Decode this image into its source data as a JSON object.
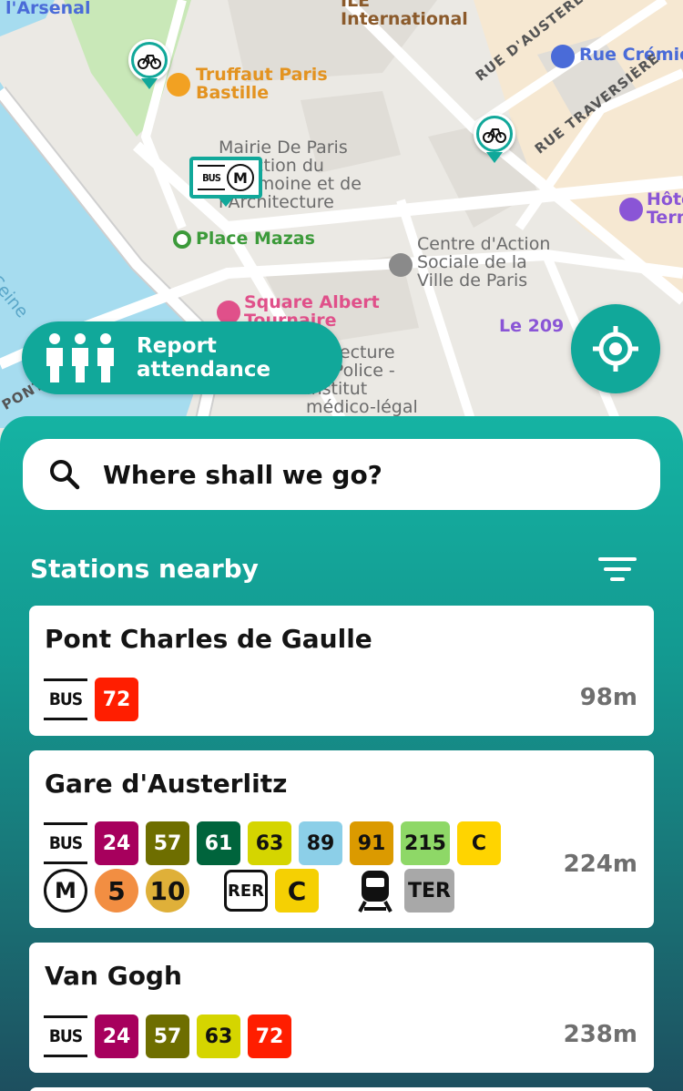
{
  "map": {
    "labels": {
      "arsenal": "l'Arsenal",
      "ile_international": "ILE\nInternational",
      "truffaut": "Truffaut Paris\nBastille",
      "rue_cremieux": "Rue Crémieux",
      "mairie": "Mairie De Paris\nDirection du\nPatrimoine et de\nl'Architecture",
      "place_mazas": "Place Mazas",
      "centre_action": "Centre d'Action\nSociale de la\nVille de Paris",
      "square_albert": "Square Albert\nTournaire",
      "le_209": "Le 209",
      "prefecture": "Préfecture\nde Police -\nInstitut\nmédico-légal",
      "hotel": "Hôtel\nTerminus",
      "rue_traversiere": "RUE TRAVERSIÈRE",
      "rue_austerlitz": "RUE D'AUSTERLITZ",
      "seine": "Seine",
      "pont": "PONT"
    },
    "colors": {
      "water": "#a6dcef",
      "park": "#c9e8b8",
      "road": "#ffffff",
      "block": "#e8e5df",
      "accent": "#11a89a"
    },
    "stop_pin": {
      "bus": "BUS",
      "metro": "M"
    },
    "report_button": "Report attendance",
    "locate_icon": "crosshair-icon"
  },
  "search": {
    "placeholder": "Where shall we go?",
    "icon": "search-icon"
  },
  "stations": {
    "title": "Stations nearby",
    "filter_icon": "filter-icon",
    "items": [
      {
        "name": "Pont Charles de Gaulle",
        "distance": "98m",
        "bus_label": "BUS",
        "bus_lines": [
          {
            "label": "72",
            "bg": "#ff1e00",
            "fg": "#ffffff"
          }
        ]
      },
      {
        "name": "Gare d'Austerlitz",
        "distance": "224m",
        "bus_label": "BUS",
        "bus_lines": [
          {
            "label": "24",
            "bg": "#a7005d",
            "fg": "#ffffff"
          },
          {
            "label": "57",
            "bg": "#6e6e00",
            "fg": "#ffffff"
          },
          {
            "label": "61",
            "bg": "#00643c",
            "fg": "#ffffff"
          },
          {
            "label": "63",
            "bg": "#d5d500",
            "fg": "#111111"
          },
          {
            "label": "89",
            "bg": "#8ccfe8",
            "fg": "#111111"
          },
          {
            "label": "91",
            "bg": "#db9a00",
            "fg": "#111111"
          },
          {
            "label": "215",
            "bg": "#8ed867",
            "fg": "#111111"
          },
          {
            "label": "C",
            "bg": "#ffd400",
            "fg": "#111111"
          }
        ],
        "metro_label": "M",
        "metro_lines": [
          {
            "label": "5",
            "bg": "#f28e42",
            "fg": "#111111"
          },
          {
            "label": "10",
            "bg": "#dfb039",
            "fg": "#111111"
          }
        ],
        "rer_label": "RER",
        "rer_lines": [
          {
            "label": "C",
            "bg": "#f5d003",
            "fg": "#111111"
          }
        ],
        "train_icon": "train-icon",
        "train_lines": [
          {
            "label": "TER",
            "bg": "#a8a8a8",
            "fg": "#111111"
          }
        ]
      },
      {
        "name": "Van Gogh",
        "distance": "238m",
        "bus_label": "BUS",
        "bus_lines": [
          {
            "label": "24",
            "bg": "#a7005d",
            "fg": "#ffffff"
          },
          {
            "label": "57",
            "bg": "#6e6e00",
            "fg": "#ffffff"
          },
          {
            "label": "63",
            "bg": "#d5d500",
            "fg": "#111111"
          },
          {
            "label": "72",
            "bg": "#ff1e00",
            "fg": "#ffffff"
          }
        ]
      }
    ]
  }
}
